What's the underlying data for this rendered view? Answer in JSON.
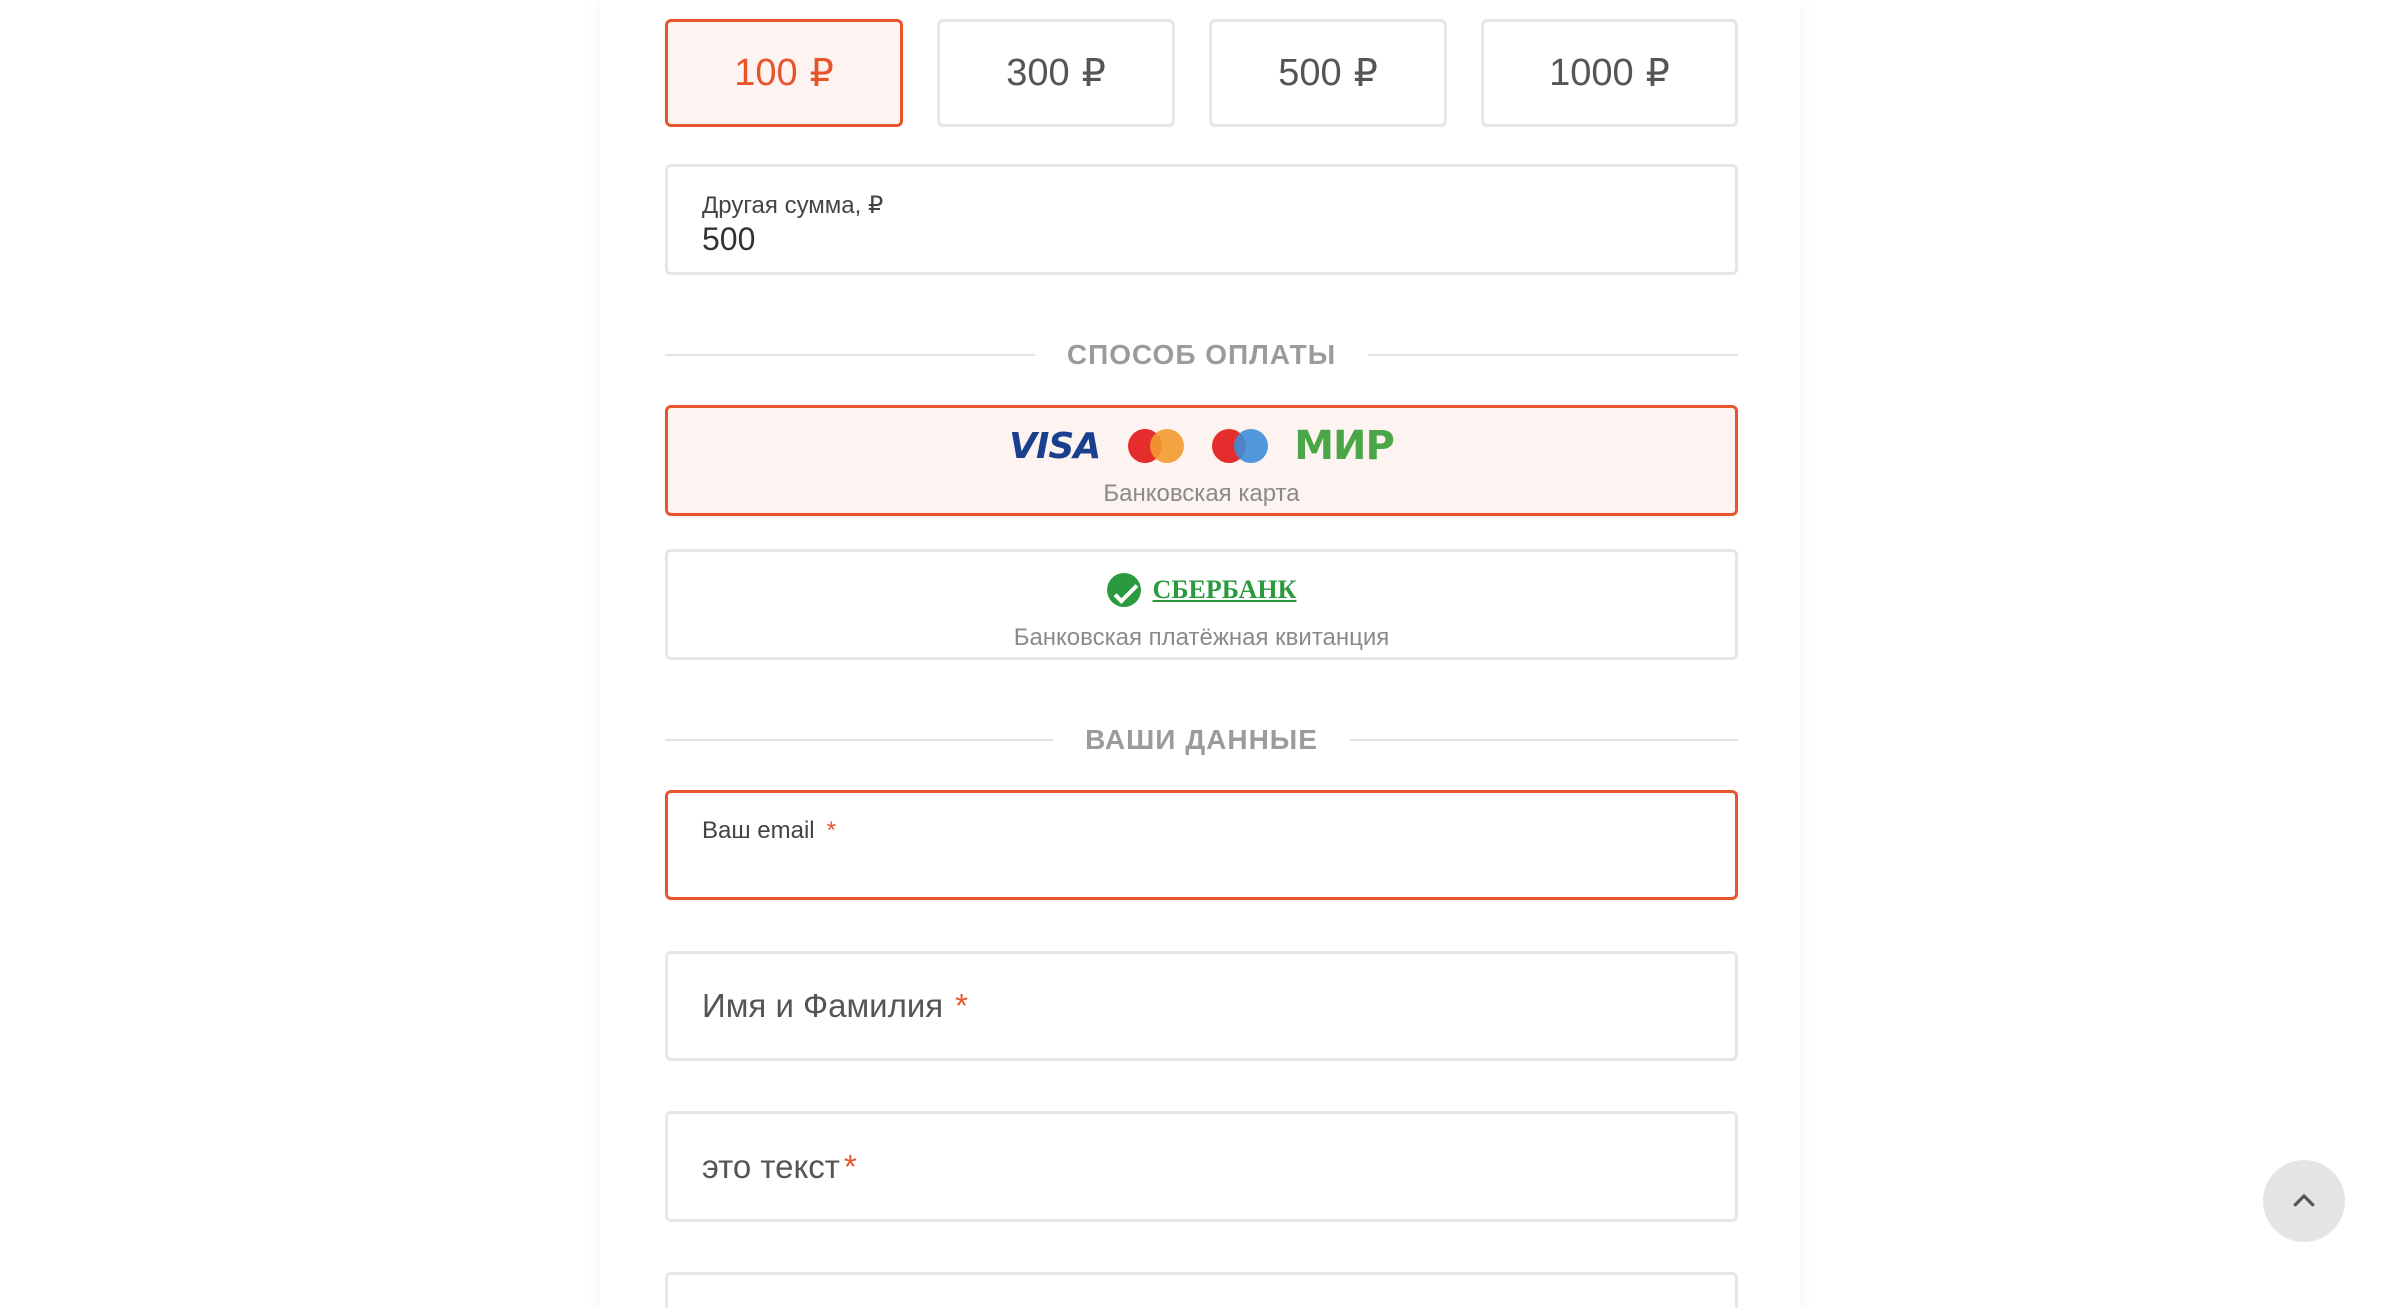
{
  "amounts": {
    "currency": "₽",
    "options": [
      {
        "value": "100",
        "selected": true
      },
      {
        "value": "300",
        "selected": false
      },
      {
        "value": "500",
        "selected": false
      },
      {
        "value": "1000",
        "selected": false
      }
    ]
  },
  "other_amount": {
    "label": "Другая сумма, ₽",
    "value": "500"
  },
  "payment_section": {
    "title": "СПОСОБ ОПЛАТЫ",
    "methods": [
      {
        "id": "card",
        "logos": [
          "VISA",
          "mastercard",
          "maestro",
          "МИР"
        ],
        "caption": "Банковская карта",
        "selected": true
      },
      {
        "id": "sberbank",
        "logo_text": "СБЕРБАНК",
        "caption": "Банковская платёжная квитанция",
        "selected": false
      }
    ]
  },
  "data_section": {
    "title": "ВАШИ ДАННЫЕ",
    "fields": {
      "email": {
        "label": "Ваш email",
        "required_mark": "*",
        "value": ""
      },
      "name": {
        "label": "Имя и Фамилия",
        "required_mark": "*",
        "value": ""
      },
      "text": {
        "label": "это текст",
        "required_mark": "*",
        "value": ""
      }
    }
  },
  "scroll_top": {
    "icon": "chevron-up-icon"
  },
  "colors": {
    "accent": "#e8552d",
    "accent_bg": "#fdf3f0",
    "border": "#e6e6e6",
    "section_title": "#9b9b9b"
  }
}
